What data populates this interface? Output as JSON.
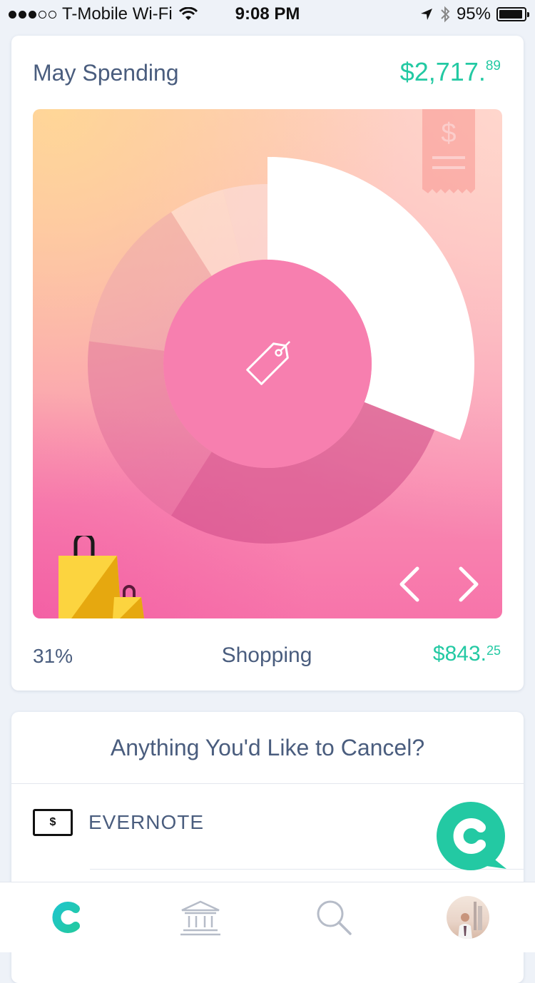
{
  "status_bar": {
    "carrier": "T-Mobile Wi-Fi",
    "time": "9:08 PM",
    "battery": "95%",
    "signal_bars_filled": 3,
    "signal_bars_total": 5,
    "battery_level": 0.95
  },
  "spending": {
    "title": "May Spending",
    "total_main": "$2,717.",
    "total_cents": "89",
    "selected_category": {
      "percent": "31%",
      "name": "Shopping",
      "amount_main": "$843.",
      "amount_cents": "25"
    },
    "icons": {
      "receipt": "receipt-icon",
      "center": "price-tag-icon",
      "bag": "shopping-bag-icon",
      "prev": "chevron-left-icon",
      "next": "chevron-right-icon"
    }
  },
  "chart_data": {
    "type": "pie",
    "style": "donut",
    "selected_index": 0,
    "categories": [
      "Shopping",
      "",
      "",
      "",
      "",
      ""
    ],
    "values": [
      31,
      28,
      18,
      14,
      5,
      4
    ],
    "colors": [
      "#ffffff",
      "#cd4a86",
      "#dc6a9a",
      "#e59ab0",
      "#fde5e2",
      "#fce0e0"
    ],
    "opacities": [
      1,
      0.55,
      0.45,
      0.38,
      0.55,
      0.6
    ]
  },
  "cancel_section": {
    "title": "Anything You'd Like to Cancel?",
    "items": [
      {
        "name": "EVERNOTE",
        "icon_symbol": "$"
      }
    ]
  },
  "tab_bar": {
    "items": [
      "home-logo-icon",
      "bank-icon",
      "search-icon",
      "profile-avatar"
    ],
    "active_index": 0,
    "accent_color": "#1ec6c9"
  },
  "colors": {
    "accent_green": "#23c9a3",
    "text": "#4a5d7e",
    "background": "#eef2f8"
  }
}
